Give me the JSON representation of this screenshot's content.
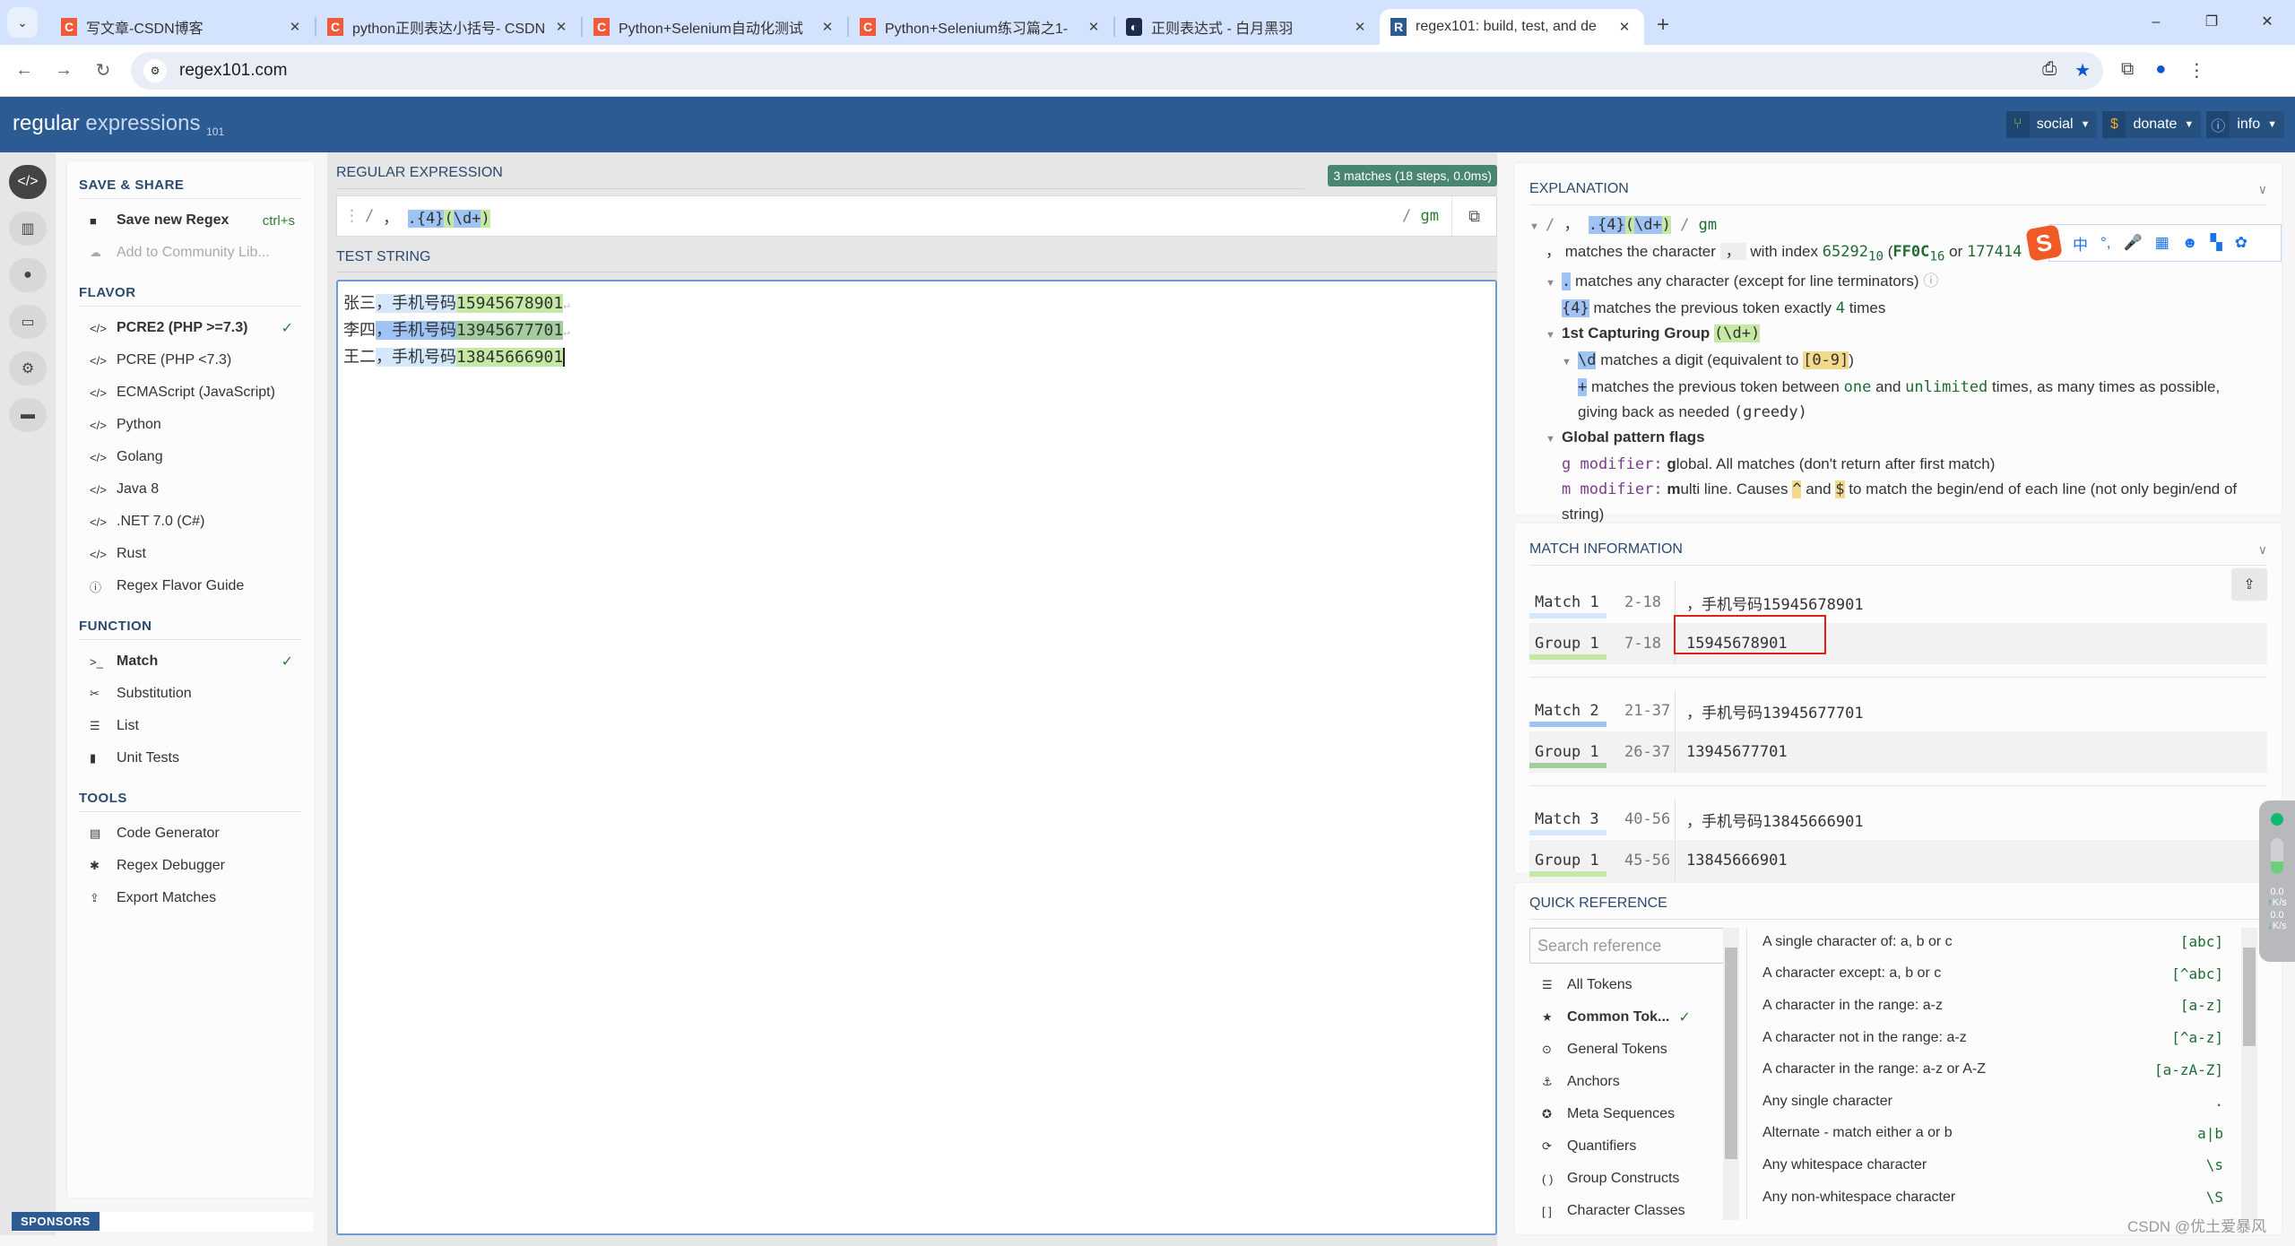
{
  "browser": {
    "tabs": [
      {
        "title": "写文章-CSDN博客",
        "favicon": "csdn-icon",
        "active": false
      },
      {
        "title": "python正则表达小括号- CSDN",
        "favicon": "csdn-icon",
        "active": false
      },
      {
        "title": "Python+Selenium自动化测试",
        "favicon": "csdn-icon",
        "active": false
      },
      {
        "title": "Python+Selenium练习篇之1-",
        "favicon": "csdn-icon",
        "active": false
      },
      {
        "title": "正则表达式 - 白月黑羽",
        "favicon": "moon-icon",
        "active": false
      },
      {
        "title": "regex101: build, test, and de",
        "favicon": "regex101-icon",
        "active": true
      }
    ],
    "url": "regex101.com"
  },
  "header": {
    "logo_main": "regular",
    "logo_light": "expressions",
    "logo_sub": "101",
    "buttons": [
      {
        "label": "social",
        "icon": "fork-icon",
        "icon_color": "#8bc34a"
      },
      {
        "label": "donate",
        "icon": "dollar-icon",
        "icon_color": "#f5a623"
      },
      {
        "label": "info",
        "icon": "info-icon",
        "icon_color": "#9fc3f5"
      }
    ]
  },
  "rail": [
    "code-icon",
    "library-icon",
    "user-icon",
    "gamepad-icon",
    "gear-icon",
    "chat-icon"
  ],
  "left": {
    "save_share": {
      "heading": "SAVE & SHARE",
      "save_label": "Save new Regex",
      "save_shortcut": "ctrl+s",
      "community_label": "Add to Community Lib..."
    },
    "flavor": {
      "heading": "FLAVOR",
      "items": [
        {
          "label": "PCRE2 (PHP >=7.3)",
          "selected": true
        },
        {
          "label": "PCRE (PHP <7.3)"
        },
        {
          "label": "ECMAScript (JavaScript)"
        },
        {
          "label": "Python"
        },
        {
          "label": "Golang"
        },
        {
          "label": "Java 8"
        },
        {
          "label": ".NET 7.0 (C#)"
        },
        {
          "label": "Rust"
        },
        {
          "label": "Regex Flavor Guide"
        }
      ]
    },
    "function": {
      "heading": "FUNCTION",
      "items": [
        {
          "label": "Match",
          "selected": true
        },
        {
          "label": "Substitution"
        },
        {
          "label": "List"
        },
        {
          "label": "Unit Tests"
        }
      ]
    },
    "tools": {
      "heading": "TOOLS",
      "items": [
        {
          "label": "Code Generator"
        },
        {
          "label": "Regex Debugger"
        },
        {
          "label": "Export Matches"
        }
      ]
    },
    "sponsors": "SPONSORS"
  },
  "regex": {
    "label": "REGULAR EXPRESSION",
    "match_badge": "3 matches (18 steps, 0.0ms)",
    "delim_open": "/",
    "pattern_prefix": "，",
    "pattern_dot": ".",
    "pattern_quant": "{4}",
    "pattern_group_open": "(",
    "pattern_group_body": "\\d+",
    "pattern_group_close": ")",
    "delim_close": "/",
    "flags": "gm"
  },
  "test_string": {
    "label": "TEST STRING",
    "lines": [
      {
        "pre": "张三",
        "match": "，手机号码",
        "group": "15945678901",
        "newline": true
      },
      {
        "pre": "李四",
        "match": "，手机号码",
        "group": "13945677701",
        "newline": true
      },
      {
        "pre": "王二",
        "match": "，手机号码",
        "group": "13845666901",
        "newline": false
      }
    ]
  },
  "explanation": {
    "heading": "EXPLANATION",
    "root_flags": "gm",
    "line_char": "matches the character",
    "line_char_char": "，",
    "line_char_idx_pre": "with index",
    "idx_dec": "65292",
    "idx_dec_base": "10",
    "idx_hex": "FF0C",
    "idx_hex_base": "16",
    "idx_or": "or",
    "idx_oct": "177414",
    "dot_token": ".",
    "dot_desc": "matches any character (except for line terminators)",
    "quant_token": "{4}",
    "quant_desc_pre": "matches the previous token exactly",
    "quant_n": "4",
    "quant_desc_post": "times",
    "group_title": "1st Capturing Group",
    "group_token": "(\\d+)",
    "d_token": "\\d",
    "d_desc": "matches a digit (equivalent to",
    "d_class": "[0-9]",
    "plus_token": "+",
    "plus_desc_1": "matches the previous token between",
    "plus_one": "one",
    "plus_and": "and",
    "plus_unl": "unlimited",
    "plus_desc_2": "times, as many times as possible, giving back as needed",
    "plus_greedy": "(greedy)",
    "flags_title": "Global pattern flags",
    "g_mod": "g modifier:",
    "g_bold": "g",
    "g_desc": "lobal. All matches (don't return after first match)",
    "m_mod": "m modifier:",
    "m_bold": "m",
    "m_desc_1": "ulti line. Causes",
    "m_caret": "^",
    "m_and": "and",
    "m_dollar": "$",
    "m_desc_2": "to match the begin/end of each line (not only begin/end of string)"
  },
  "ime_toolbar": {
    "logo": "S",
    "items": [
      "中",
      "°,",
      "mic-icon",
      "keyboard-icon",
      "face-icon",
      "apps-icon",
      "skin-icon"
    ]
  },
  "match_info": {
    "heading": "MATCH INFORMATION",
    "matches": [
      {
        "name": "Match 1",
        "range": "2-18",
        "value": "，手机号码15945678901",
        "group_name": "Group 1",
        "group_range": "7-18",
        "group_value": "15945678901"
      },
      {
        "name": "Match 2",
        "range": "21-37",
        "value": "，手机号码13945677701",
        "group_name": "Group 1",
        "group_range": "26-37",
        "group_value": "13945677701"
      },
      {
        "name": "Match 3",
        "range": "40-56",
        "value": "，手机号码13845666901",
        "group_name": "Group 1",
        "group_range": "45-56",
        "group_value": "13845666901"
      }
    ]
  },
  "quick_ref": {
    "heading": "QUICK REFERENCE",
    "search_placeholder": "Search reference",
    "categories": [
      {
        "label": "All Tokens",
        "icon": "stack-icon"
      },
      {
        "label": "Common Tok...",
        "icon": "star-icon",
        "selected": true
      },
      {
        "label": "General Tokens",
        "icon": "target-icon"
      },
      {
        "label": "Anchors",
        "icon": "anchor-icon"
      },
      {
        "label": "Meta Sequences",
        "icon": "lifebuoy-icon"
      },
      {
        "label": "Quantifiers",
        "icon": "repeat-icon"
      },
      {
        "label": "Group Constructs",
        "icon": "parens-icon"
      },
      {
        "label": "Character Classes",
        "icon": "brackets-icon"
      }
    ],
    "items": [
      {
        "desc": "A single character of: a, b or c",
        "token": "[abc]"
      },
      {
        "desc": "A character except: a, b or c",
        "token": "[^abc]"
      },
      {
        "desc": "A character in the range: a-z",
        "token": "[a-z]"
      },
      {
        "desc": "A character not in the range: a-z",
        "token": "[^a-z]"
      },
      {
        "desc": "A character in the range: a-z or A-Z",
        "token": "[a-zA-Z]"
      },
      {
        "desc": "Any single character",
        "token": "."
      },
      {
        "desc": "Alternate - match either a or b",
        "token": "a|b"
      },
      {
        "desc": "Any whitespace character",
        "token": "\\s"
      },
      {
        "desc": "Any non-whitespace character",
        "token": "\\S"
      }
    ]
  },
  "net_widget": {
    "up": "0.0",
    "down": "0.0",
    "unit": "K/s"
  },
  "watermark": "CSDN @优土爱暴风"
}
